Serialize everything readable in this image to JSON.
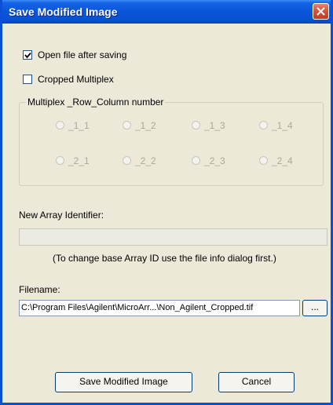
{
  "window": {
    "title": "Save Modified Image",
    "close_icon": "close-icon",
    "accent_color": "#0a55d9"
  },
  "options": {
    "open_after_saving": {
      "label": "Open file after saving",
      "checked": true
    },
    "cropped_multiplex": {
      "label": "Cropped Multiplex",
      "checked": false
    }
  },
  "multiplex_group": {
    "legend": "Multiplex _Row_Column number",
    "radios": [
      "_1_1",
      "_1_2",
      "_1_3",
      "_1_4",
      "_2_1",
      "_2_2",
      "_2_3",
      "_2_4"
    ]
  },
  "array_identifier": {
    "label": "New Array Identifier:",
    "value": "",
    "hint": "(To change base Array ID use the file info dialog first.)"
  },
  "filename": {
    "label": "Filename:",
    "value": "C:\\Program Files\\Agilent\\MicroArr...\\Non_Agilent_Cropped.tif",
    "browse_label": "..."
  },
  "buttons": {
    "save": "Save Modified Image",
    "cancel": "Cancel"
  }
}
